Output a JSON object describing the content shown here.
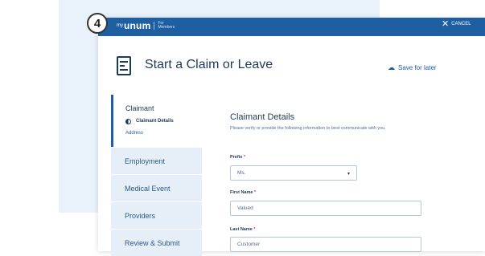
{
  "step_number": "4",
  "brand": {
    "my": "my",
    "name": "unum",
    "for_line1": "For",
    "for_line2": "Members"
  },
  "header": {
    "cancel_label": "CANCEL",
    "page_title": "Start a Claim or Leave",
    "save_label": "Save for later"
  },
  "sidebar": {
    "active_section": "Claimant",
    "sub_items": [
      "Claimant Details",
      "Address"
    ],
    "items": [
      "Employment",
      "Medical Event",
      "Providers",
      "Review & Submit"
    ]
  },
  "main": {
    "section_title": "Claimant Details",
    "description": "Please verify or provide the following information to best communicate with you.",
    "fields": [
      {
        "label": "Prefix",
        "required": "*",
        "value": "Ms."
      },
      {
        "label": "First Name",
        "required": "*",
        "value": "Valued"
      },
      {
        "label": "Last Name",
        "required": "*",
        "value": "Customer"
      }
    ]
  },
  "colors": {
    "brand_blue": "#1d5fa0",
    "navy": "#1c3a57",
    "panel_bg": "#e9f1fa"
  }
}
